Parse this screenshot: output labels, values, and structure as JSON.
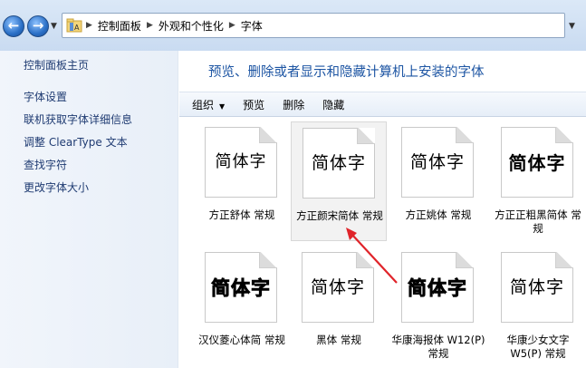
{
  "window": {
    "breadcrumbs": [
      "控制面板",
      "外观和个性化",
      "字体"
    ]
  },
  "left_pane": {
    "items": [
      {
        "label": "控制面板主页"
      },
      {
        "label": "字体设置"
      },
      {
        "label": "联机获取字体详细信息"
      },
      {
        "label": "调整 ClearType 文本"
      },
      {
        "label": "查找字符"
      },
      {
        "label": "更改字体大小"
      }
    ]
  },
  "main": {
    "title": "预览、删除或者显示和隐藏计算机上安装的字体",
    "toolbar": {
      "organize": "组织",
      "preview": "预览",
      "delete": "删除",
      "hide": "隐藏"
    },
    "fonts": [
      {
        "sample": "简体字",
        "name": "方正舒体 常规",
        "style": "thin"
      },
      {
        "sample": "简体字",
        "name": "方正颜宋简体 常规",
        "style": "reg",
        "selected": true
      },
      {
        "sample": "简体字",
        "name": "方正姚体 常规",
        "style": "reg"
      },
      {
        "sample": "简体字",
        "name": "方正正粗黑简体 常规",
        "style": "bold"
      },
      {
        "sample": "简体字",
        "name": "汉仪菱心体简 常规",
        "style": "black"
      },
      {
        "sample": "简体字",
        "name": "黑体 常规",
        "style": "reg"
      },
      {
        "sample": "简体字",
        "name": "华康海报体 W12(P) 常规",
        "style": "black"
      },
      {
        "sample": "简体字",
        "name": "华康少女文字 W5(P) 常规",
        "style": "reg"
      }
    ]
  },
  "colors": {
    "title": "#1d55a3",
    "link": "#1f3b72",
    "annotation_arrow": "#e0242a"
  }
}
